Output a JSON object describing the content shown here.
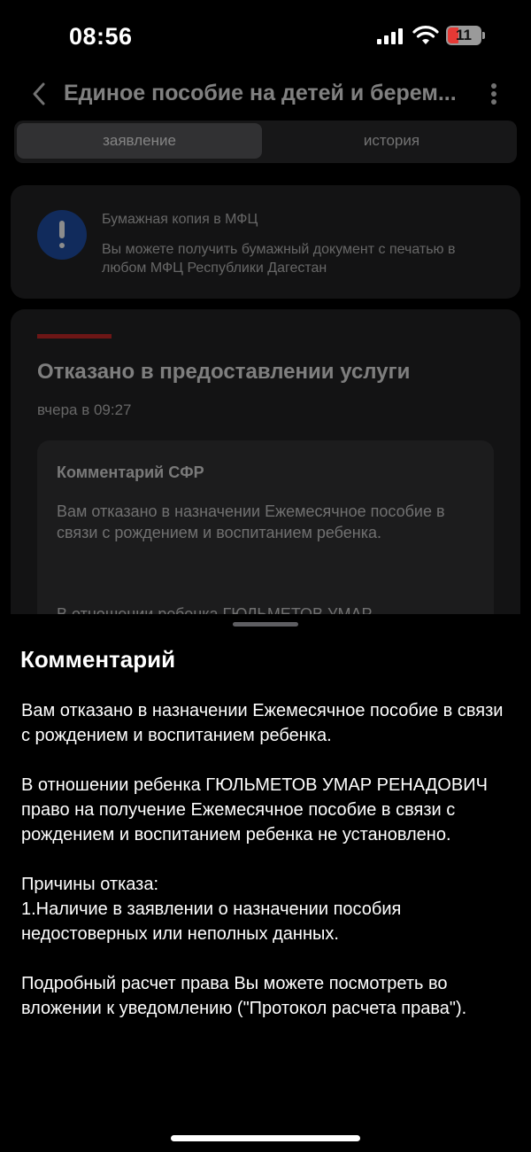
{
  "status_bar": {
    "time": "08:56",
    "battery_level": "11",
    "battery_color": "#e53935"
  },
  "nav": {
    "title": "Единое пособие на детей и берем...",
    "back_icon": "chevron-left-icon",
    "more_icon": "more-vertical-icon"
  },
  "tabs": [
    {
      "label": "заявление",
      "active": true
    },
    {
      "label": "история",
      "active": false
    }
  ],
  "mfc_card": {
    "icon": "info-exclamation-icon",
    "title": "Бумажная копия в МФЦ",
    "text": "Вы можете получить бумажный документ с печатью в любом МФЦ Республики Дагестан"
  },
  "status_card": {
    "accent_color": "#c62828",
    "title": "Отказано в предоставлении услуги",
    "time": "вчера в 09:27",
    "comment_title": "Комментарий СФР",
    "comment_text": "Вам отказано в назначении Ежемесячное пособие в связи с рождением и воспитанием ребенка.",
    "comment_text_cut": "В отношении ребенка ГЮЛЬМЕТОВ УМАР"
  },
  "sheet": {
    "title": "Комментарий",
    "paragraphs": [
      "Вам отказано в назначении Ежемесячное пособие в связи с рождением и воспитанием ребенка.\n ",
      "В отношении ребенка ГЮЛЬМЕТОВ УМАР РЕНАДОВИЧ право на получение Ежемесячное пособие в связи с рождением и воспитанием ребенка не установлено.",
      "Причины отказа:\n1.Наличие в заявлении о назначении пособия недостоверных или неполных данных.",
      "Подробный расчет права Вы можете посмотреть во вложении к уведомлению (\"Протокол расчета права\")."
    ]
  }
}
